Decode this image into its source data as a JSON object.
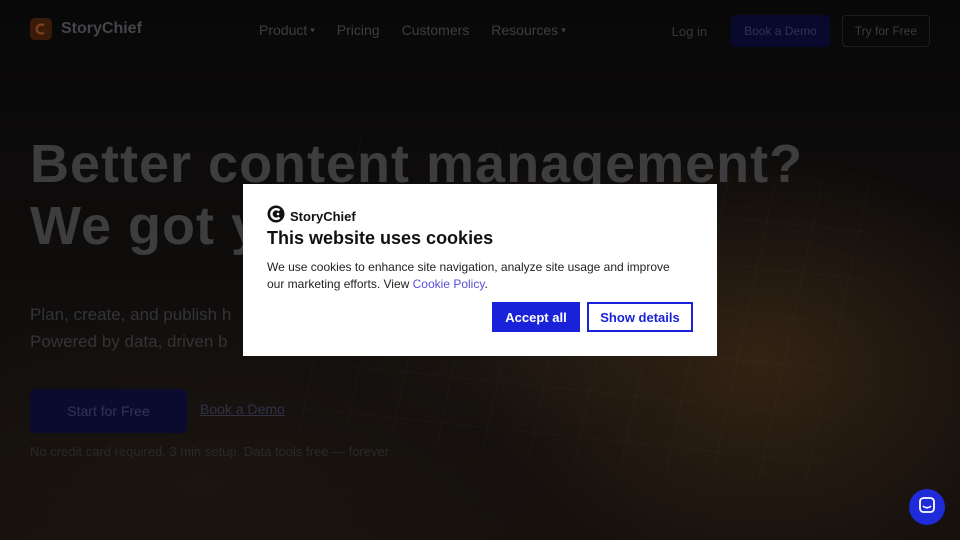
{
  "nav": {
    "brand": "StoryChief",
    "links": [
      {
        "label": "Product",
        "has_dropdown": true
      },
      {
        "label": "Pricing",
        "has_dropdown": false
      },
      {
        "label": "Customers",
        "has_dropdown": false
      },
      {
        "label": "Resources",
        "has_dropdown": true
      }
    ],
    "login_label": "Log in",
    "demo_label": "Book a Demo",
    "try_label": "Try for Free"
  },
  "hero": {
    "title_line1": "Better content management?",
    "title_line2": "We got y",
    "subtitle_line1": "Plan, create, and publish h",
    "subtitle_line2": "Powered by data, driven b",
    "start_label": "Start for Free",
    "demo_link": "Book a Demo",
    "note": "No credit card required. 3 min setup. Data tools free — forever"
  },
  "cookie": {
    "brand": "StoryChief",
    "title": "This website uses cookies",
    "text_before": "We use cookies to enhance site navigation, analyze site usage and improve our marketing efforts. View ",
    "link_label": "Cookie Policy",
    "text_after": ".",
    "accept_label": "Accept all",
    "details_label": "Show details"
  },
  "colors": {
    "accent": "#1a22d9",
    "link": "#5b4fd6",
    "backdrop": "#0b0b0d"
  },
  "icons": {
    "chevron": "chevron-down-icon",
    "chat": "chat-icon",
    "logo": "storychief-logo-icon"
  }
}
